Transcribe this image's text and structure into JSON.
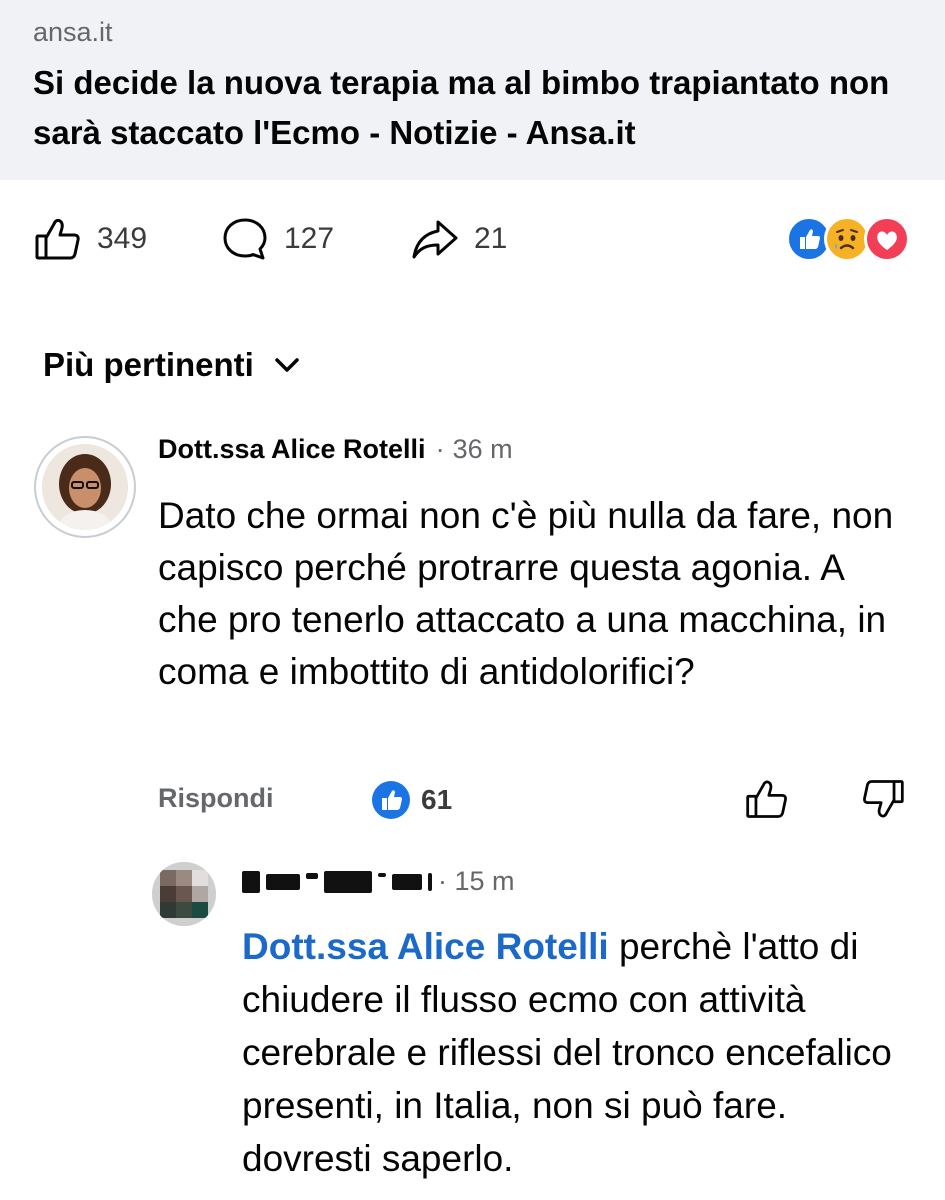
{
  "link_preview": {
    "domain": "ansa.it",
    "title": "Si decide la nuova terapia ma al bimbo trapiantato non sarà staccato l'Ecmo - Notizie - Ansa.it"
  },
  "actions": {
    "likes": "349",
    "comments": "127",
    "shares": "21",
    "reaction_icons": [
      "like-reaction-icon",
      "sad-reaction-icon",
      "love-reaction-icon"
    ]
  },
  "sort": {
    "label": "Più pertinenti"
  },
  "comment": {
    "author": "Dott.ssa Alice Rotelli",
    "separator": "·",
    "time": "36 m",
    "text": "Dato che ormai non c'è più nulla da fare, non capisco perché protrarre questa agonia. A che pro tenerlo attaccato a una macchina, in coma e imbottito di antidolorifici?",
    "reply_label": "Rispondi",
    "like_count": "61"
  },
  "reply": {
    "separator": "·",
    "time": "15 m",
    "mention": "Dott.ssa Alice Rotelli",
    "text": " perchè l'atto di chiudere il flusso ecmo con attività cerebrale e riflessi del tronco encefalico presenti, in Italia, non si può fare. dovresti saperlo."
  },
  "colors": {
    "facebook_blue": "#1b74e4",
    "mention_blue": "#1b6ac9",
    "card_bg": "#f0f2f5",
    "love_red": "#f33e58",
    "sad_yellow": "#f7b125"
  }
}
